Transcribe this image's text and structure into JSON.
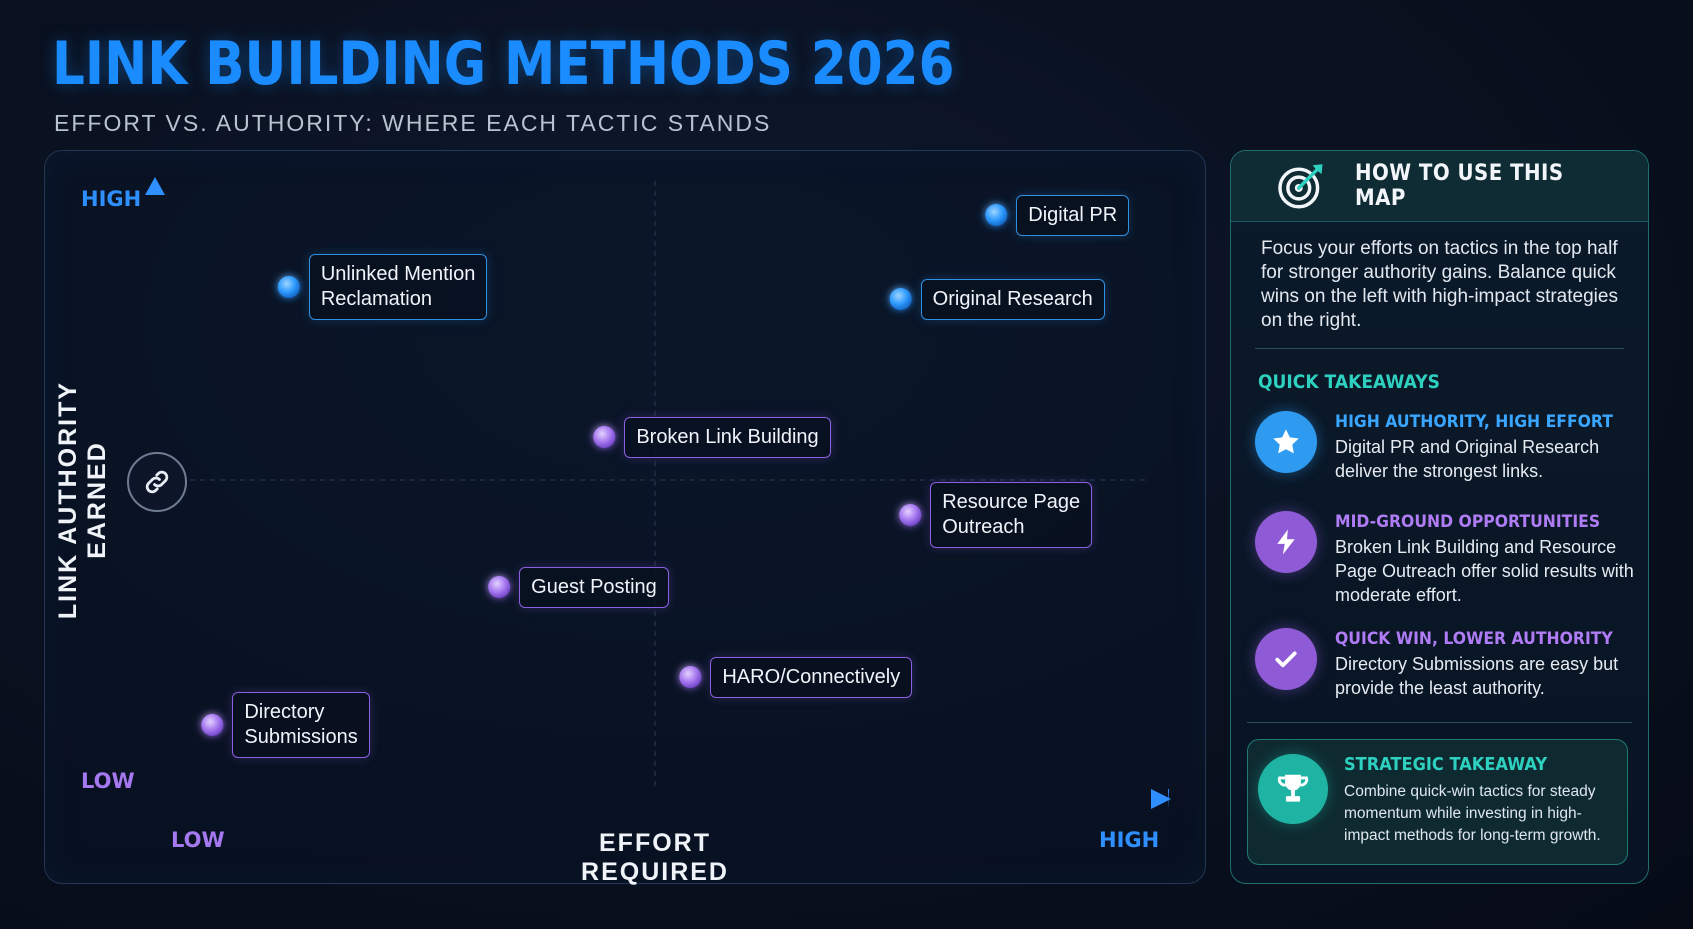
{
  "header": {
    "title": "LINK BUILDING METHODS 2026",
    "subtitle": "EFFORT VS. AUTHORITY: WHERE EACH TACTIC STANDS"
  },
  "chart_data": {
    "type": "scatter",
    "xlabel": "EFFORT REQUIRED",
    "ylabel": "LINK AUTHORITY EARNED",
    "x_low_label": "LOW",
    "x_high_label": "HIGH",
    "y_low_label": "LOW",
    "y_high_label": "HIGH",
    "xlim": [
      0,
      10
    ],
    "ylim": [
      0,
      10
    ],
    "grid": "dashed quadrant lines at midpoints",
    "colors": {
      "high_authority": "#2f9bff",
      "mid_low": "#a678f0"
    },
    "points": [
      {
        "label": "Digital PR",
        "x": 8.8,
        "y": 9.6,
        "color": "blue"
      },
      {
        "label": "Original Research",
        "x": 7.8,
        "y": 8.2,
        "color": "blue"
      },
      {
        "label": "Unlinked Mention\nReclamation",
        "x": 1.4,
        "y": 8.4,
        "color": "blue"
      },
      {
        "label": "Broken Link Building",
        "x": 4.7,
        "y": 5.9,
        "color": "purple"
      },
      {
        "label": "Resource Page\nOutreach",
        "x": 7.9,
        "y": 4.6,
        "color": "purple"
      },
      {
        "label": "Guest Posting",
        "x": 3.6,
        "y": 3.4,
        "color": "purple"
      },
      {
        "label": "HARO/Connectively",
        "x": 5.6,
        "y": 1.9,
        "color": "purple"
      },
      {
        "label": "Directory\nSubmissions",
        "x": 0.6,
        "y": 1.1,
        "color": "purple"
      }
    ]
  },
  "side_panel": {
    "title": "HOW TO USE THIS MAP",
    "icon": "target-icon",
    "intro": "Focus your efforts on tactics in the top half for stronger authority gains. Balance quick wins on the left with high-impact strategies on the right.",
    "quick_takeaways_title": "QUICK TAKEAWAYS",
    "takeaways": [
      {
        "icon": "star-icon",
        "heading": "HIGH AUTHORITY, HIGH EFFORT",
        "body": "Digital PR and Original Research deliver the strongest links.",
        "color": "#2e9bf0"
      },
      {
        "icon": "lightning-icon",
        "heading": "MID-GROUND OPPORTUNITIES",
        "body": "Broken Link Building and Resource Page Outreach offer solid results with moderate effort.",
        "color": "#8e5ad6"
      },
      {
        "icon": "checkmark-icon",
        "heading": "QUICK WIN, LOWER AUTHORITY",
        "body": "Directory Submissions are easy but provide the least authority.",
        "color": "#8e5ad6"
      }
    ],
    "strategic": {
      "icon": "trophy-icon",
      "heading": "STRATEGIC TAKEAWAY",
      "body": "Combine quick-win tactics for steady momentum while investing in high-impact methods for long-term growth."
    }
  }
}
